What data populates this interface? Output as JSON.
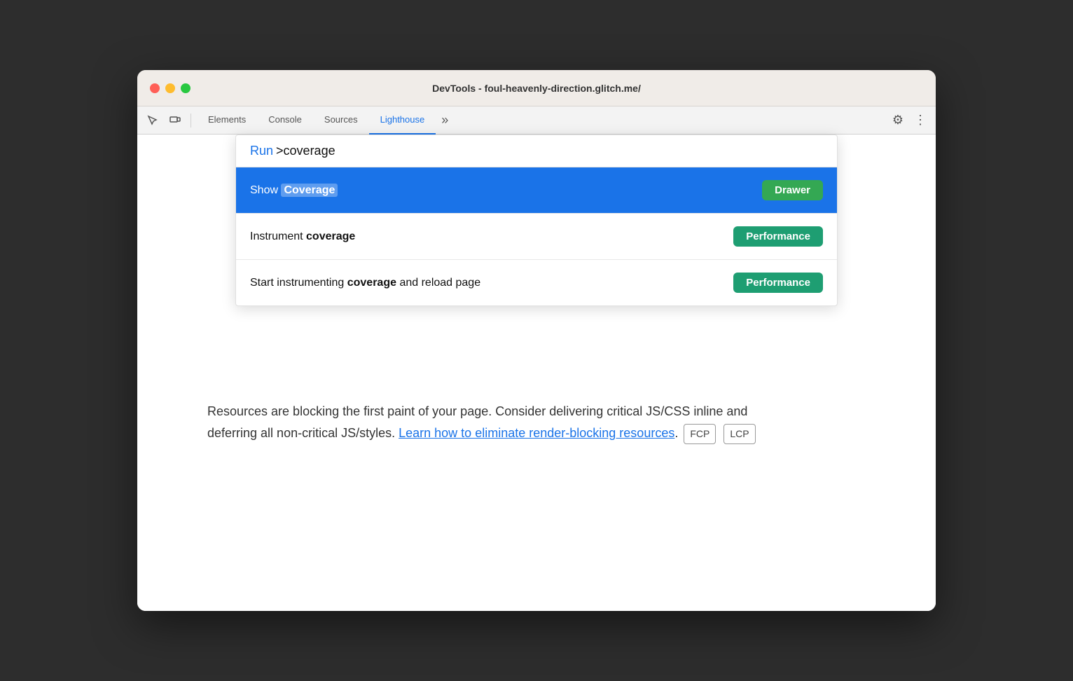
{
  "window": {
    "title": "DevTools - foul-heavenly-direction.glitch.me/"
  },
  "toolbar": {
    "tabs": [
      {
        "label": "Elements",
        "active": false
      },
      {
        "label": "Console",
        "active": false
      },
      {
        "label": "Sources",
        "active": false
      },
      {
        "label": "Lighthouse",
        "active": true
      }
    ],
    "more_icon": "»",
    "settings_icon": "⚙",
    "more_options_icon": "⋮"
  },
  "command_palette": {
    "run_label": "Run",
    "input_value": ">coverage",
    "results": [
      {
        "id": "show-coverage",
        "text_prefix": "Show ",
        "text_keyword": "Coverage",
        "badge_label": "Drawer",
        "badge_type": "drawer",
        "highlighted": true
      },
      {
        "id": "instrument-coverage",
        "text_prefix": "Instrument ",
        "text_keyword": "coverage",
        "badge_label": "Performance",
        "badge_type": "performance",
        "highlighted": false
      },
      {
        "id": "start-instrumenting-coverage",
        "text_prefix": "Start instrumenting ",
        "text_keyword": "coverage",
        "text_suffix": " and reload page",
        "badge_label": "Performance",
        "badge_type": "performance",
        "highlighted": false
      }
    ]
  },
  "page_content": {
    "description": "Resources are blocking the first paint of your page. Consider delivering critical JS/CSS inline and deferring all non-critical JS/styles.",
    "link_text": "Learn how to eliminate render-blocking resources",
    "link_suffix": ".",
    "badges": [
      "FCP",
      "LCP"
    ]
  }
}
